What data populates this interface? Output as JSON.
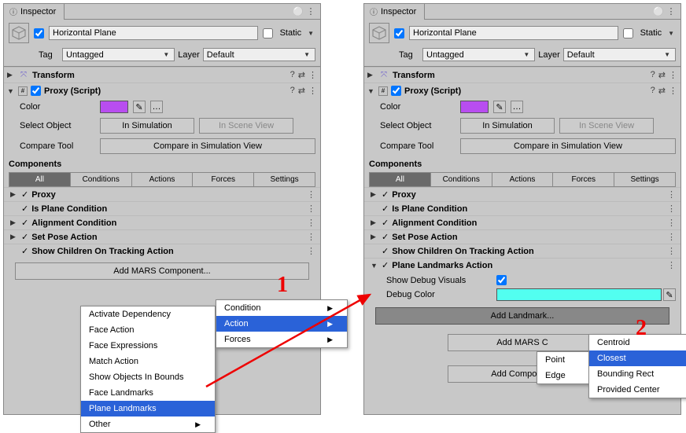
{
  "tab": {
    "title": "Inspector"
  },
  "gameObject": {
    "name": "Horizontal Plane",
    "static_label": "Static",
    "tag_label": "Tag",
    "tag_value": "Untagged",
    "layer_label": "Layer",
    "layer_value": "Default"
  },
  "transform": {
    "label": "Transform"
  },
  "proxy": {
    "label": "Proxy (Script)",
    "color_label": "Color",
    "color_value": "#b84df0",
    "select_label": "Select Object",
    "in_sim": "In Simulation",
    "in_scene": "In Scene View",
    "compare_label": "Compare Tool",
    "compare_btn": "Compare in Simulation View"
  },
  "components_label": "Components",
  "tabs": {
    "all": "All",
    "conditions": "Conditions",
    "actions": "Actions",
    "forces": "Forces",
    "settings": "Settings"
  },
  "list": {
    "proxy": "Proxy",
    "is_plane": "Is Plane Condition",
    "alignment": "Alignment Condition",
    "set_pose": "Set Pose Action",
    "show_children": "Show Children On Tracking Action",
    "plane_landmarks": "Plane Landmarks Action"
  },
  "landmarks": {
    "show_debug": "Show Debug Visuals",
    "debug_color": "Debug Color",
    "debug_color_value": "#52fff0",
    "add_landmark_btn": "Add Landmark..."
  },
  "add_mars_btn": "Add MARS Component...",
  "add_mars_short": "Add MARS C",
  "add_component_btn": "Add Component",
  "menu1": {
    "items": [
      "Activate Dependency",
      "Face Action",
      "Face Expressions",
      "Match Action",
      "Show Objects In Bounds",
      "Face Landmarks",
      "Plane Landmarks",
      "Other"
    ],
    "sub": [
      "Condition",
      "Action",
      "Forces"
    ]
  },
  "menu2": {
    "left": [
      "Point",
      "Edge"
    ],
    "right": [
      "Centroid",
      "Closest",
      "Bounding Rect",
      "Provided Center"
    ]
  },
  "annotations": {
    "one": "1",
    "two": "2"
  }
}
